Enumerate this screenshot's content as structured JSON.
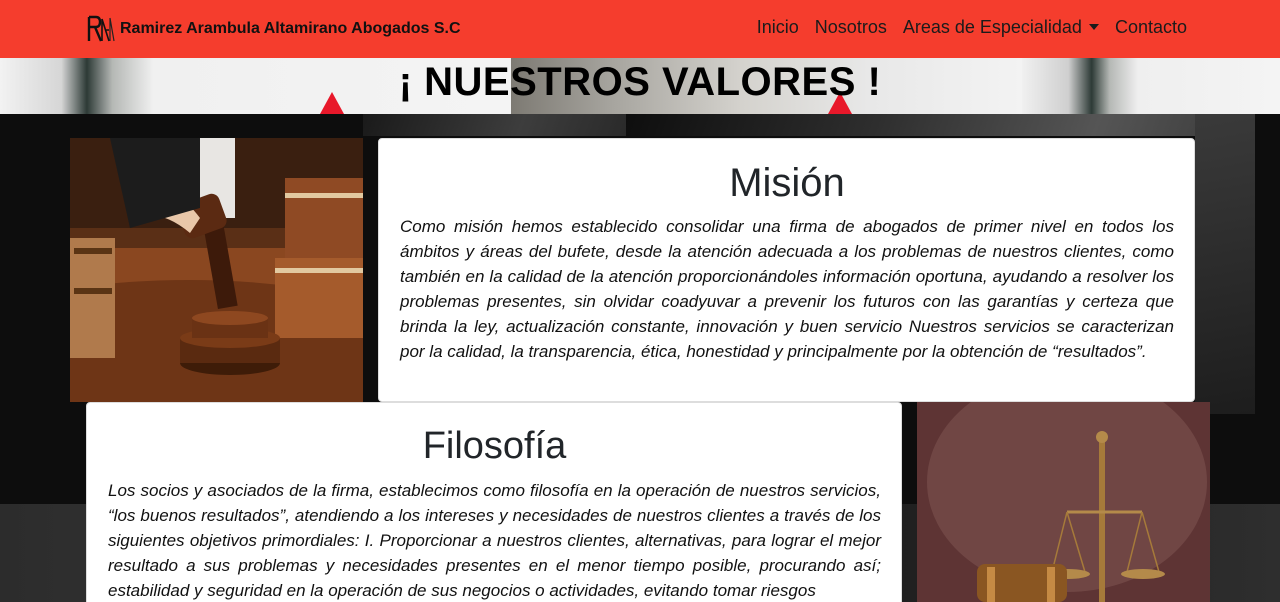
{
  "navbar": {
    "brand_name": "Ramirez Arambula Altamirano Abogados S.C",
    "bg_color": "#f53d2d",
    "links": [
      {
        "label": "Inicio"
      },
      {
        "label": "Nosotros"
      },
      {
        "label": "Areas de Especialidad"
      },
      {
        "label": "Contacto"
      }
    ]
  },
  "banner": {
    "title": "¡ NUESTROS VALORES !"
  },
  "mision": {
    "title": "Misión",
    "text": "Como misión hemos establecido consolidar una firma de abogados de primer nivel en todos los ámbitos y áreas del bufete, desde la atención adecuada a los problemas de nuestros clientes, como también en la calidad de la atención proporcionándoles información oportuna, ayudando a resolver los problemas presentes, sin olvidar coadyuvar a prevenir los futuros con las garantías y certeza que brinda la ley, actualización constante, innovación y buen servicio Nuestros servicios se caracterizan por la calidad, la transparencia, ética, honestidad y principalmente por la obtención de “resultados”."
  },
  "filosofia": {
    "title": "Filosofía",
    "text": "Los socios y asociados de la firma, establecimos como filosofía en la operación de nuestros servicios, “los buenos resultados”, atendiendo a los intereses y necesidades de nuestros clientes a través de los siguientes objetivos primordiales: I. Proporcionar a nuestros clientes, alternativas, para lograr el mejor resultado a sus problemas y necesidades presentes en el menor tiempo posible, procurando así; estabilidad y seguridad en la operación de sus negocios o actividades, evitando tomar riesgos"
  }
}
